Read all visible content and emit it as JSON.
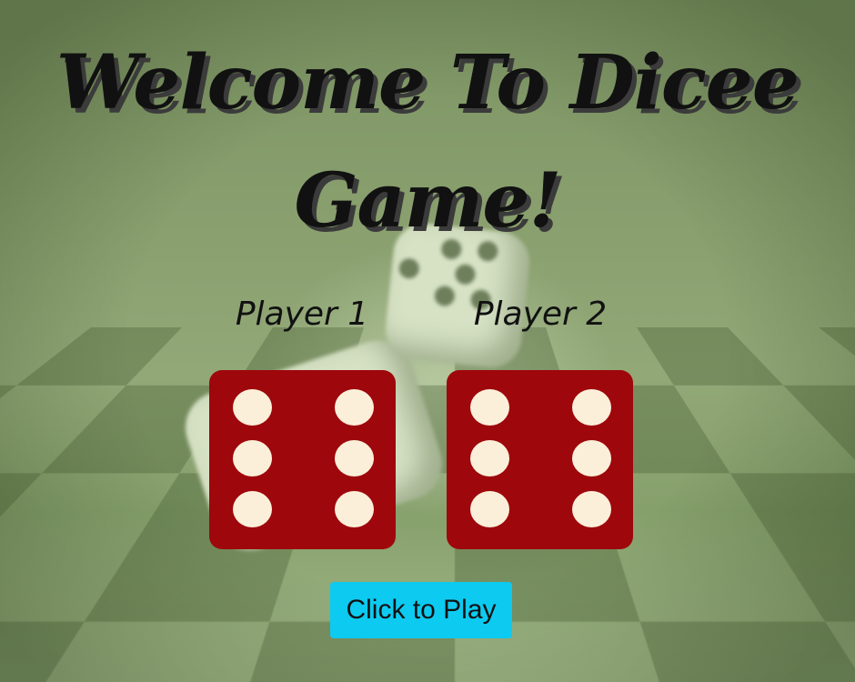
{
  "game": {
    "title_line1": "Welcome To Dicee",
    "title_line2": "Game!",
    "player1_label": "Player 1",
    "player2_label": "Player 2",
    "player1_die_value": 6,
    "player2_die_value": 6,
    "play_button_label": "Click to Play"
  },
  "colors": {
    "die_face": "#9e070c",
    "pip": "#fbefd9",
    "button": "#0dcaf0",
    "background": "#8aa06f"
  }
}
